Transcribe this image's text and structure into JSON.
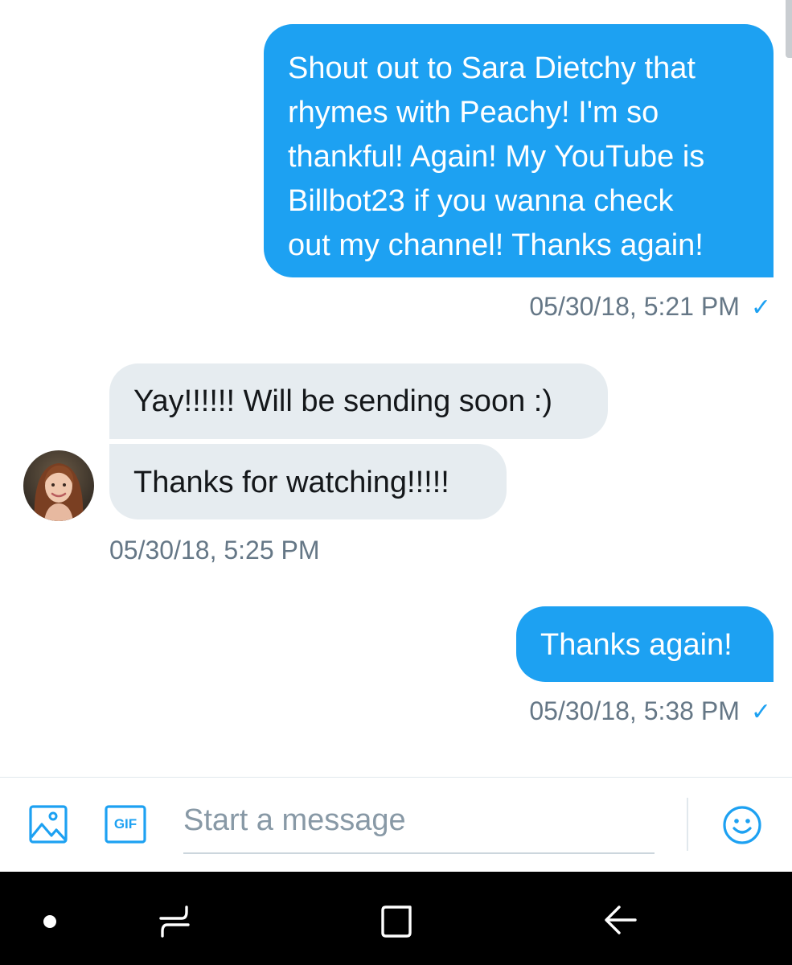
{
  "conversation": {
    "messages": [
      {
        "direction": "outgoing",
        "lines": [
          "Shout out to Sara Dietchy that",
          "rhymes with Peachy! I'm so",
          "thankful! Again! My YouTube is",
          "Billbot23 if you wanna check",
          "out my channel! Thanks again!"
        ],
        "timestamp": "05/30/18, 5:21 PM",
        "status_icon": "check-icon"
      },
      {
        "direction": "incoming",
        "text": "Yay!!!!!! Will be sending soon :)"
      },
      {
        "direction": "incoming",
        "text": "Thanks for watching!!!!!",
        "timestamp": "05/30/18, 5:25 PM",
        "avatar_icon": "avatar-photo"
      },
      {
        "direction": "outgoing",
        "text": "Thanks again!",
        "timestamp": "05/30/18, 5:38 PM",
        "status_icon": "check-icon"
      }
    ],
    "check_mark": "✓"
  },
  "composer": {
    "placeholder": "Start a message",
    "gif_label": "GIF",
    "icons": [
      "image-icon",
      "gif-icon",
      "emoji-icon"
    ]
  },
  "system_nav": {
    "icons": [
      "dot-icon",
      "recents-icon",
      "home-icon",
      "back-icon"
    ]
  },
  "colors": {
    "accent": "#1da1f2",
    "incoming_bubble": "#e6ecf0",
    "timestamp_text": "#657786",
    "nav_bar": "#000000"
  }
}
